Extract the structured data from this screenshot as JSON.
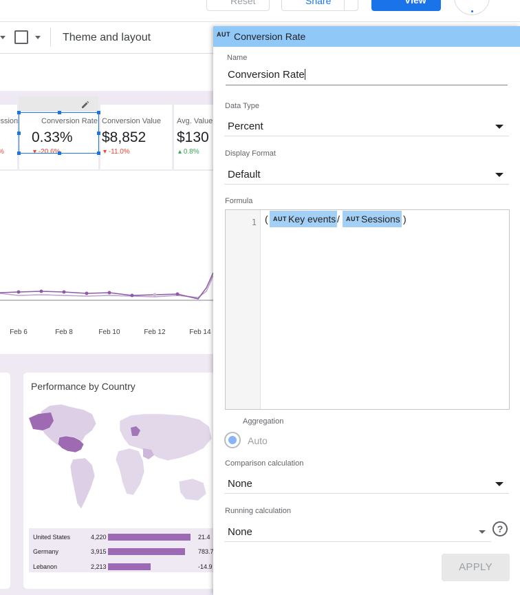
{
  "topbar": {
    "reset_label": "Reset",
    "share_label": "Share",
    "view_label": "View"
  },
  "toolbar": {
    "theme_label": "Theme and layout"
  },
  "report": {
    "kpis": [
      {
        "label": "Sessions",
        "value": "",
        "delta": "%",
        "trend": "down"
      },
      {
        "label": "Conversion Rate",
        "value": "0.33%",
        "delta": "-20.6%",
        "trend": "down"
      },
      {
        "label": "Conversion Value",
        "value": "$8,852",
        "delta": "-11.0%",
        "trend": "down"
      },
      {
        "label": "Avg. Value",
        "value": "$130",
        "delta": "0.8%",
        "trend": "up"
      }
    ],
    "timeseries": {
      "x_labels": [
        "Feb 6",
        "Feb 8",
        "Feb 10",
        "Feb 12",
        "Feb 14"
      ]
    },
    "country_card": {
      "title": "Performance by Country",
      "rows": [
        {
          "country": "United States",
          "value": "4,220",
          "bar": 1.0,
          "pct": "21.4"
        },
        {
          "country": "Germany",
          "value": "3,915",
          "bar": 0.93,
          "pct": "783.7"
        },
        {
          "country": "Lebanon",
          "value": "2,213",
          "bar": 0.52,
          "pct": "-14.9"
        }
      ]
    }
  },
  "panel": {
    "aut_tag": "AUT",
    "title": "Conversion Rate",
    "name_label": "Name",
    "name_value": "Conversion Rate",
    "data_type_label": "Data Type",
    "data_type_value": "Percent",
    "display_format_label": "Display Format",
    "display_format_value": "Default",
    "formula_label": "Formula",
    "formula": {
      "line_number": "1",
      "open_paren": "(",
      "field_a": "Key events",
      "operator": "/",
      "field_b": "Sessions",
      "close_paren": ")"
    },
    "aggregation_label": "Aggregation",
    "aggregation_value": "Auto",
    "comparison_label": "Comparison calculation",
    "comparison_value": "None",
    "running_label": "Running calculation",
    "running_value": "None",
    "help_glyph": "?",
    "apply_label": "APPLY"
  },
  "colors": {
    "accent": "#1a73e8",
    "header_bg": "#90c8f8",
    "chip_bg": "#a5d0f5",
    "report_purple": "#9c6ab4",
    "negative": "#ea4335",
    "positive": "#34a853"
  }
}
